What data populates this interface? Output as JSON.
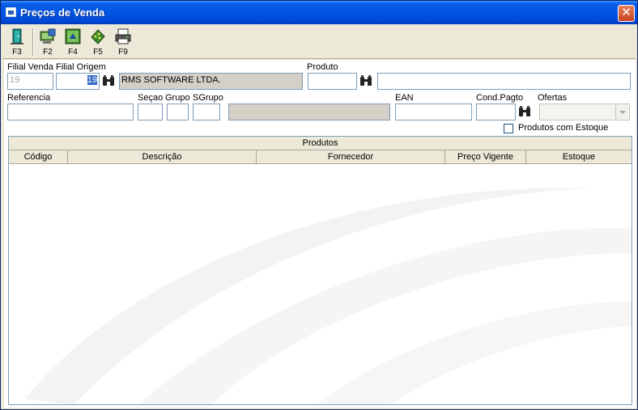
{
  "window": {
    "title": "Preços de Venda",
    "close_label": "✕"
  },
  "toolbar": {
    "buttons": [
      {
        "key": "F3",
        "icon": "exit-door-icon"
      },
      {
        "key": "F2",
        "icon": "new-record-icon"
      },
      {
        "key": "F4",
        "icon": "refresh-icon"
      },
      {
        "key": "F5",
        "icon": "diskette-icon"
      },
      {
        "key": "F9",
        "icon": "print-icon"
      }
    ]
  },
  "form": {
    "filial_venda": {
      "label": "Filial Venda",
      "value": "19"
    },
    "filial_origem": {
      "label": "Filial Origem",
      "value": "19",
      "description": "RMS SOFTWARE LTDA."
    },
    "produto": {
      "label": "Produto",
      "value": "",
      "description": ""
    },
    "referencia": {
      "label": "Referencia",
      "value": ""
    },
    "secao": {
      "label": "Seçao",
      "value": ""
    },
    "grupo": {
      "label": "Grupo",
      "value": ""
    },
    "sgrupo": {
      "label": "SGrupo",
      "value": "",
      "description": ""
    },
    "ean": {
      "label": "EAN",
      "value": ""
    },
    "cond_pagto": {
      "label": "Cond.Pagto",
      "value": ""
    },
    "ofertas": {
      "label": "Ofertas",
      "selected": ""
    },
    "produtos_com_estoque": {
      "label": "Produtos com Estoque",
      "checked": false
    }
  },
  "grid": {
    "band_title": "Produtos",
    "columns": [
      "Código",
      "Descrição",
      "Fornecedor",
      "Preço Vigente",
      "Estoque"
    ],
    "rows": []
  }
}
